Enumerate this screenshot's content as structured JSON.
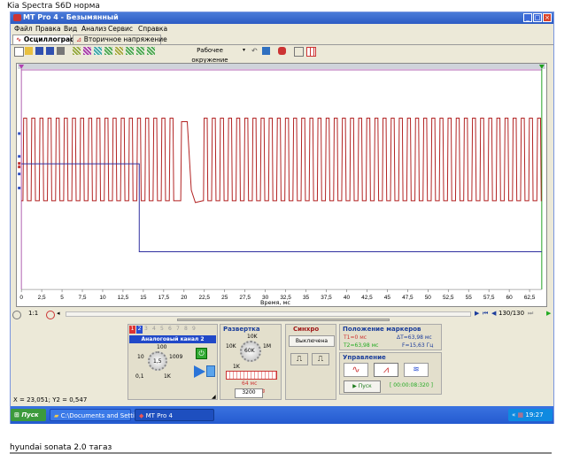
{
  "doc_title": "Kia Spectra S6D норма",
  "footer_text": "hyundai sonata 2.0 тагаз",
  "app": {
    "title": "MT Pro 4 - Безымянный",
    "menu": [
      "Файл",
      "Правка",
      "Вид",
      "Анализ",
      "Сервис",
      "Справка"
    ],
    "tabs": [
      "Осциллограф",
      "Вторичное напряжение"
    ],
    "toolbar_label": "Рабочее окружение"
  },
  "chart_data": {
    "type": "line",
    "xlabel": "Время, мс",
    "xlim": [
      0,
      64
    ],
    "x_ticks": [
      "0",
      "2,5",
      "5",
      "7,5",
      "10",
      "12,5",
      "15",
      "17,5",
      "20",
      "22,5",
      "25",
      "27,5",
      "30",
      "32,5",
      "35",
      "37,5",
      "40",
      "42,5",
      "45",
      "47,5",
      "50",
      "52,5",
      "55",
      "57,5",
      "60",
      "62,5"
    ],
    "series": [
      {
        "color": "#b22222",
        "style": "square wave, regular pulses with a gap ~19.5–22.5 ms"
      },
      {
        "color": "#3030a0",
        "style": "step: high until ~14.5 ms, then low"
      }
    ]
  },
  "scope_bottom": {
    "scale": "1:1",
    "page_counter": "130/130"
  },
  "channels": {
    "numbers": [
      "1",
      "2",
      "3",
      "4",
      "5",
      "6",
      "7",
      "8",
      "9"
    ],
    "label": "Аналоговый канал 2",
    "dial_labels": [
      "100",
      "10",
      "1,5",
      "1009",
      "0,1",
      "1K"
    ]
  },
  "sweep": {
    "title": "Развертка",
    "dial_labels": [
      "10K",
      "1M",
      "10K",
      "1K",
      "60K",
      "1K"
    ],
    "value": "64 мс",
    "points": "3200"
  },
  "sync": {
    "title": "Синхро",
    "state": "Выключена"
  },
  "markers": {
    "title": "Положение маркеров",
    "t1": "T1=0 мс",
    "t2": "T2=63,98 мс",
    "dt": "ΔT=63,98 мс",
    "f": "F=15,63 Гц"
  },
  "control": {
    "title": "Управление",
    "start": "Пуск",
    "timer": "[ 00:00:08:320 ]"
  },
  "coords": "X = 23,051; Y2 = 0,547",
  "taskbar": {
    "start": "Пуск",
    "task1": "C:\\Documents and Settin...",
    "task2": "MT Pro 4",
    "clock": "19:27"
  },
  "colors": {
    "signal_red": "#b22222",
    "signal_blue": "#3030a0",
    "window_blue": "#2c5bc4"
  }
}
